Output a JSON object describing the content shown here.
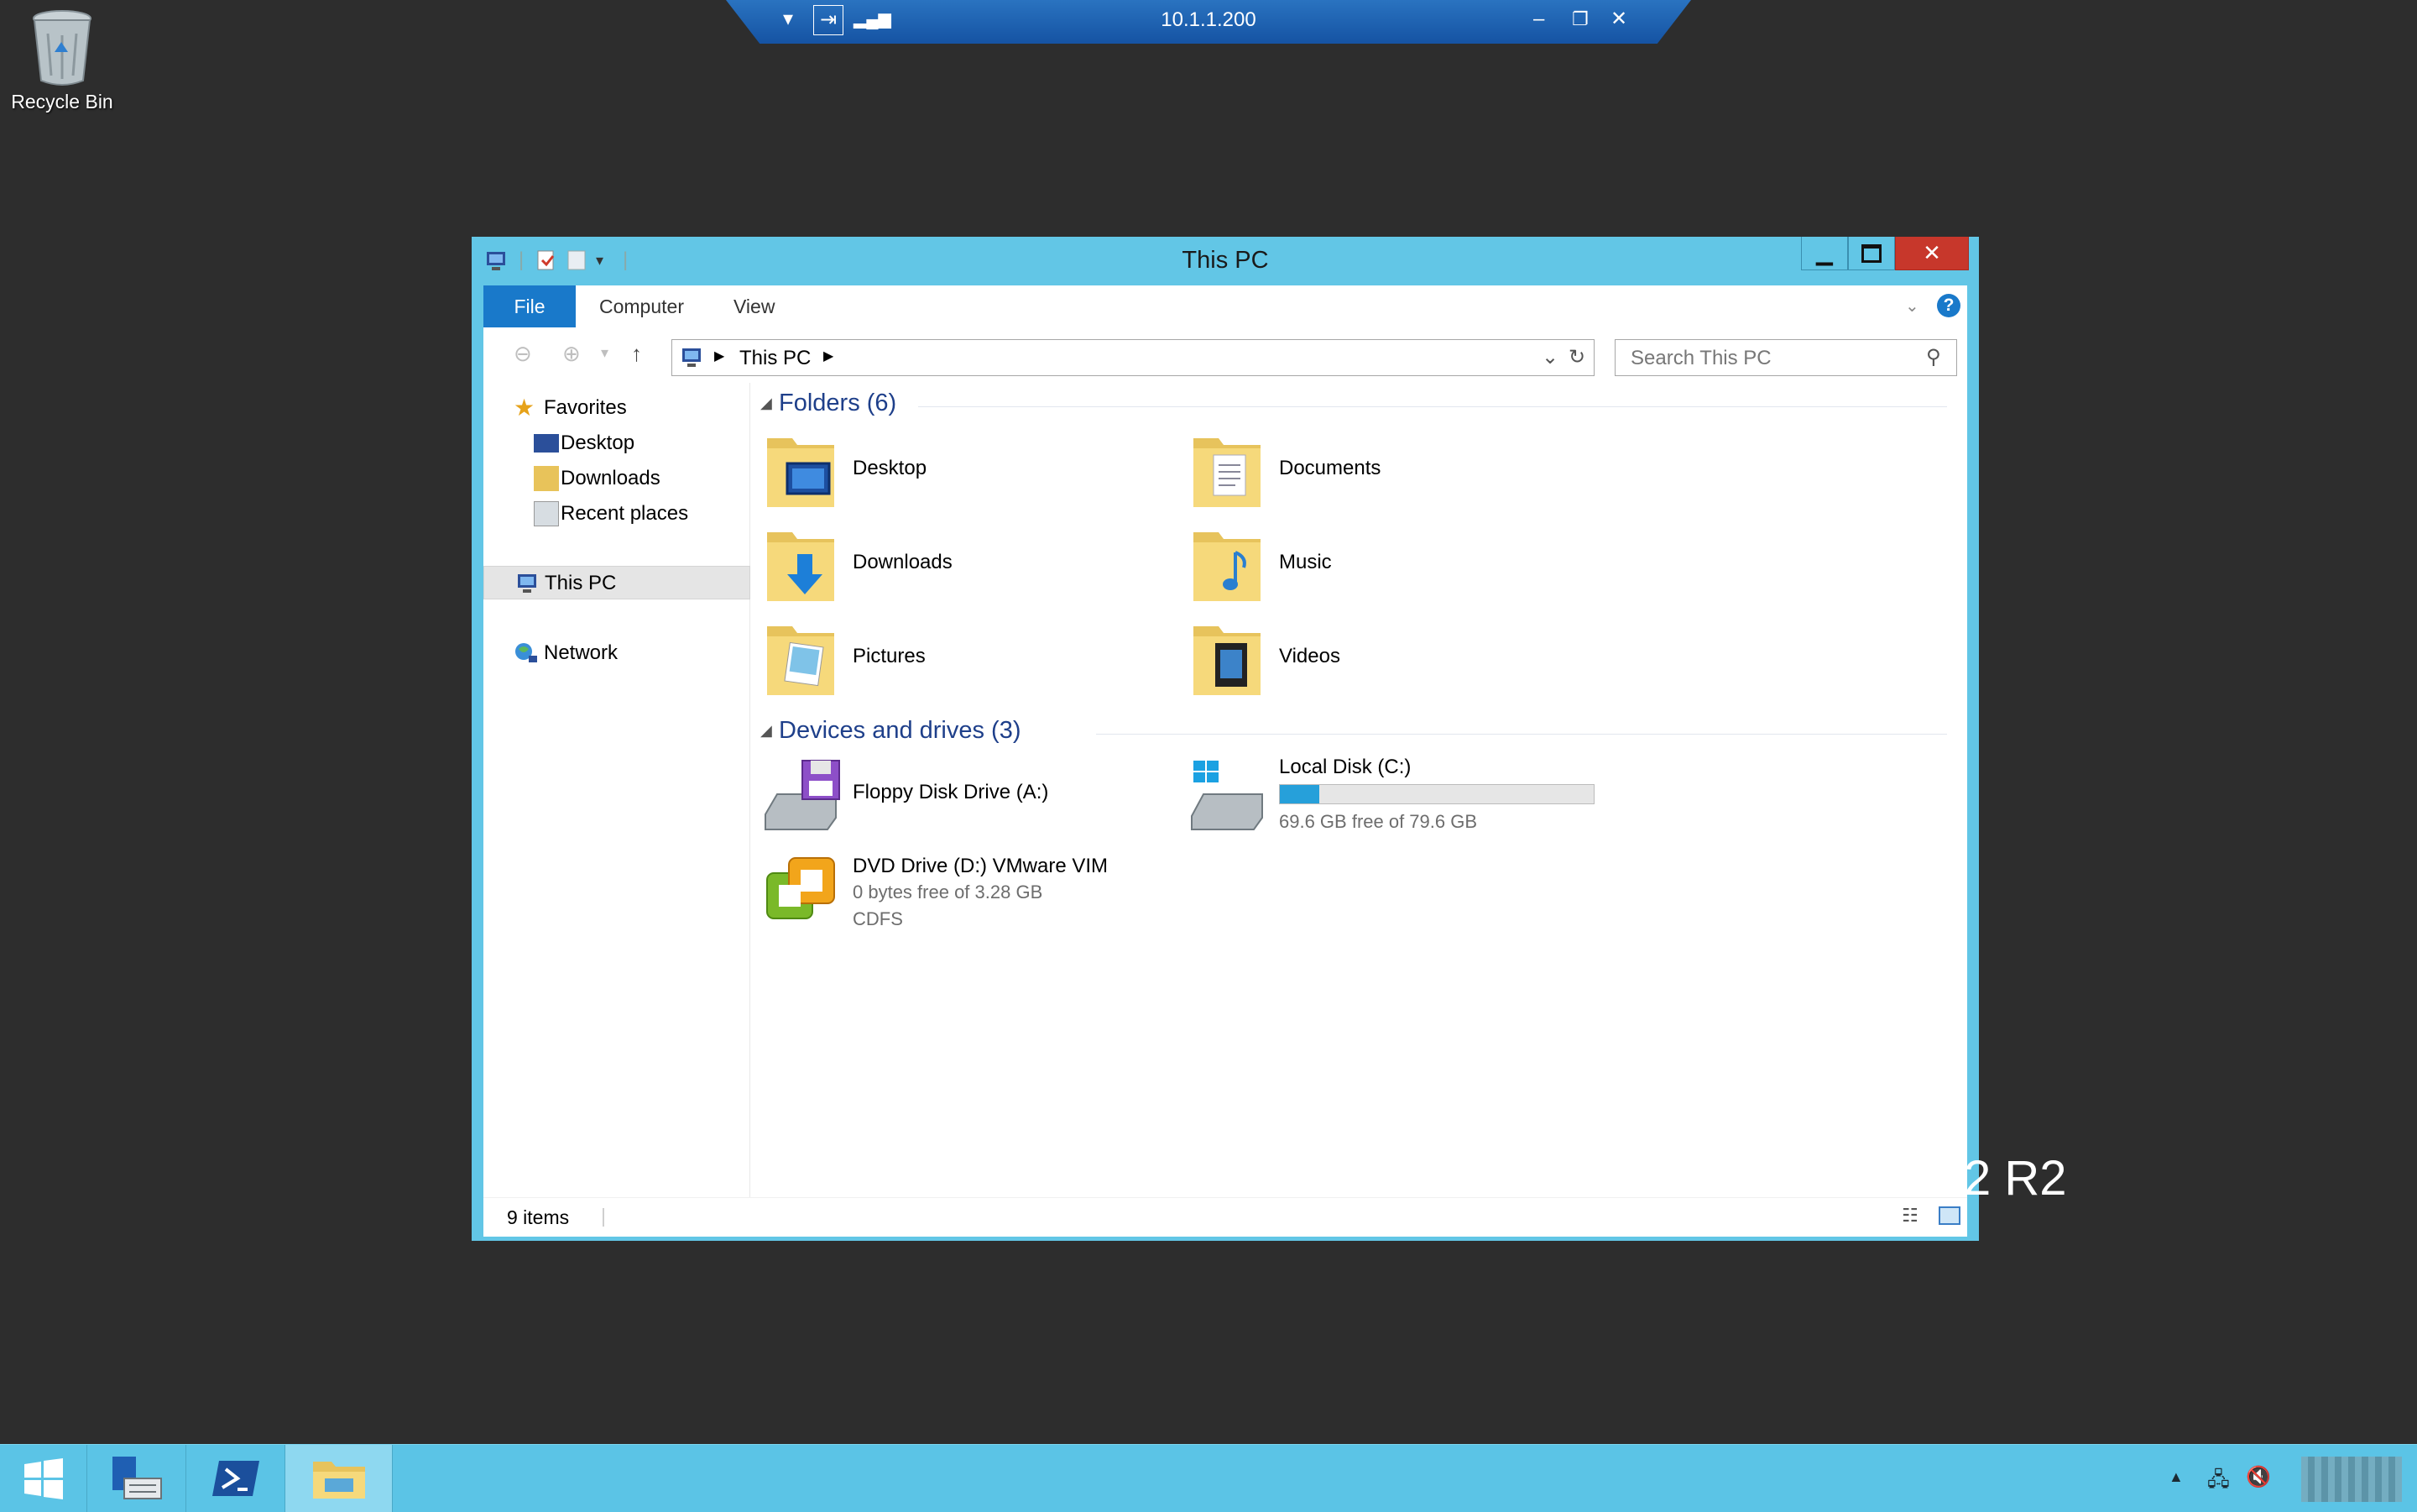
{
  "desktop": {
    "recycle_bin_label": "Recycle Bin",
    "os_watermark": "2 R2"
  },
  "remote_bar": {
    "host": "10.1.1.200"
  },
  "window": {
    "title": "This PC",
    "ribbon_tabs": [
      "File",
      "Computer",
      "View"
    ],
    "address_path": "This PC",
    "search_placeholder": "Search This PC",
    "nav": {
      "favorites": "Favorites",
      "favorite_items": [
        "Desktop",
        "Downloads",
        "Recent places"
      ],
      "this_pc": "This PC",
      "network": "Network"
    },
    "folders_header": "Folders (6)",
    "folders": [
      "Desktop",
      "Documents",
      "Downloads",
      "Music",
      "Pictures",
      "Videos"
    ],
    "drives_header": "Devices and drives (3)",
    "drives": [
      {
        "name": "Floppy Disk Drive (A:)"
      },
      {
        "name": "Local Disk (C:)",
        "space": "69.6 GB free of 79.6 GB",
        "used_fraction": 0.126
      },
      {
        "name": "DVD Drive (D:) VMware VIM",
        "space": "0 bytes free of 3.28 GB",
        "fs": "CDFS"
      }
    ],
    "status": "9 items"
  },
  "colors": {
    "window_frame": "#62c6e6",
    "file_tab": "#1979ca",
    "group_header": "#1e3f8a",
    "taskbar": "#5bc4e6",
    "drive_bar": "#26a0da"
  },
  "icons": [
    "recycle-bin-icon",
    "windows-start-icon",
    "server-manager-icon",
    "powershell-icon",
    "file-explorer-icon",
    "help-icon",
    "refresh-icon",
    "search-icon"
  ]
}
